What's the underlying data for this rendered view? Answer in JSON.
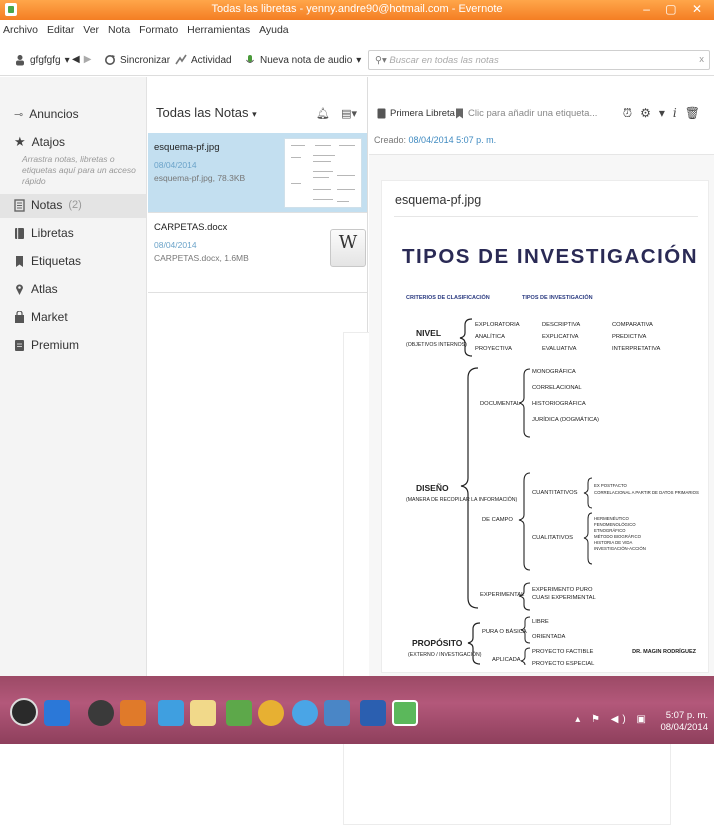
{
  "window": {
    "title": "Todas las libretas - yenny.andre90@hotmail.com - Evernote",
    "controls": "– ▢ ✕"
  },
  "menu": [
    "Archivo",
    "Editar",
    "Ver",
    "Nota",
    "Formato",
    "Herramientas",
    "Ayuda"
  ],
  "toolbar": {
    "user": "gfgfgfg",
    "sync": "Sincronizar",
    "activity": "Actividad",
    "audio_note": "Nueva nota de audio",
    "search_placeholder": "Buscar en todas las notas"
  },
  "sidebar": {
    "items": [
      {
        "label": "Anuncios",
        "icon": "megaphone-icon"
      },
      {
        "label": "Atajos",
        "icon": "star-icon"
      },
      {
        "label": "Notas",
        "count": "(2)",
        "icon": "note-icon"
      },
      {
        "label": "Libretas",
        "icon": "notebook-icon"
      },
      {
        "label": "Etiquetas",
        "icon": "tag-icon"
      },
      {
        "label": "Atlas",
        "icon": "map-pin-icon"
      },
      {
        "label": "Market",
        "icon": "market-icon"
      },
      {
        "label": "Premium",
        "icon": "premium-icon"
      }
    ],
    "shortcut_hint": "Arrastra notas, libretas o etiquetas aquí para un acceso rápido"
  },
  "notelist": {
    "header": "Todas las Notas",
    "notes": [
      {
        "title": "esquema-pf.jpg",
        "date": "08/04/2014",
        "snippet": "esquema-pf.jpg, 78.3KB"
      },
      {
        "title": "CARPETAS.docx",
        "date": "08/04/2014",
        "snippet": "CARPETAS.docx, 1.6MB",
        "icon_letter": "W",
        "icon_sub": "doc"
      }
    ]
  },
  "editor": {
    "notebook": "Primera Libreta",
    "tag_placeholder": "Clic para añadir una etiqueta...",
    "created_label": "Creado:",
    "created_value": "08/04/2014 5:07 p. m.",
    "note_title": "esquema-pf.jpg"
  },
  "infographic": {
    "title": "TIPOS DE INVESTIGACIÓN",
    "col1": "CRITERIOS DE CLASIFICACIÓN",
    "col2": "TIPOS DE INVESTIGACIÓN",
    "nivel": "NIVEL",
    "nivel_sub": "(OBJETIVOS INTERNOS)",
    "nivel_a": [
      "EXPLORATORIA",
      "ANALÍTICA",
      "PROYECTIVA"
    ],
    "nivel_b": [
      "DESCRIPTIVA",
      "EXPLICATIVA",
      "EVALUATIVA"
    ],
    "nivel_c": [
      "COMPARATIVA",
      "PREDICTIVA",
      "INTERPRETATIVA"
    ],
    "diseno": "DISEÑO",
    "diseno_sub": "(MANERA DE RECOPILAR LA INFORMACIÓN)",
    "documental": "DOCUMENTAL",
    "documental_items": [
      "MONOGRÁFICA",
      "CORRELACIONAL",
      "HISTORIOGRÁFICA",
      "JURÍDICA (DOGMÁTICA)"
    ],
    "decampo": "DE CAMPO",
    "cuantitativos": "CUANTITATIVOS",
    "cuantitativos_items": [
      "EX POSTFACTO",
      "CORRELACIONAL A PARTIR DE DATOS PRIMARIOS"
    ],
    "cualitativos": "CUALITATIVOS",
    "cualitativos_items": [
      "HERMENÉUTICO",
      "FENOMENOLÓGICO",
      "ETNOGRÁFICO",
      "MÉTODO BIOGRÁFICO",
      "HISTORIA DE VIDA",
      "INVESTIGACIÓN-ACCIÓN"
    ],
    "experimental": "EXPERIMENTAL",
    "experimental_items": [
      "EXPERIMENTO PURO",
      "CUASI EXPERIMENTAL"
    ],
    "proposito": "PROPÓSITO",
    "proposito_sub": "(EXTERNO / INVESTIGACIÓN)",
    "pura": "PURA O BÁSICA",
    "pura_items": [
      "LIBRE",
      "ORIENTADA"
    ],
    "aplicada": "APLICADA",
    "aplicada_items": [
      "PROYECTO FACTIBLE",
      "PROYECTO ESPECIAL"
    ],
    "author": "DR. MAGIN RODRÍGUEZ"
  },
  "taskbar": {
    "time": "5:07 p. m.",
    "date": "08/04/2014"
  }
}
